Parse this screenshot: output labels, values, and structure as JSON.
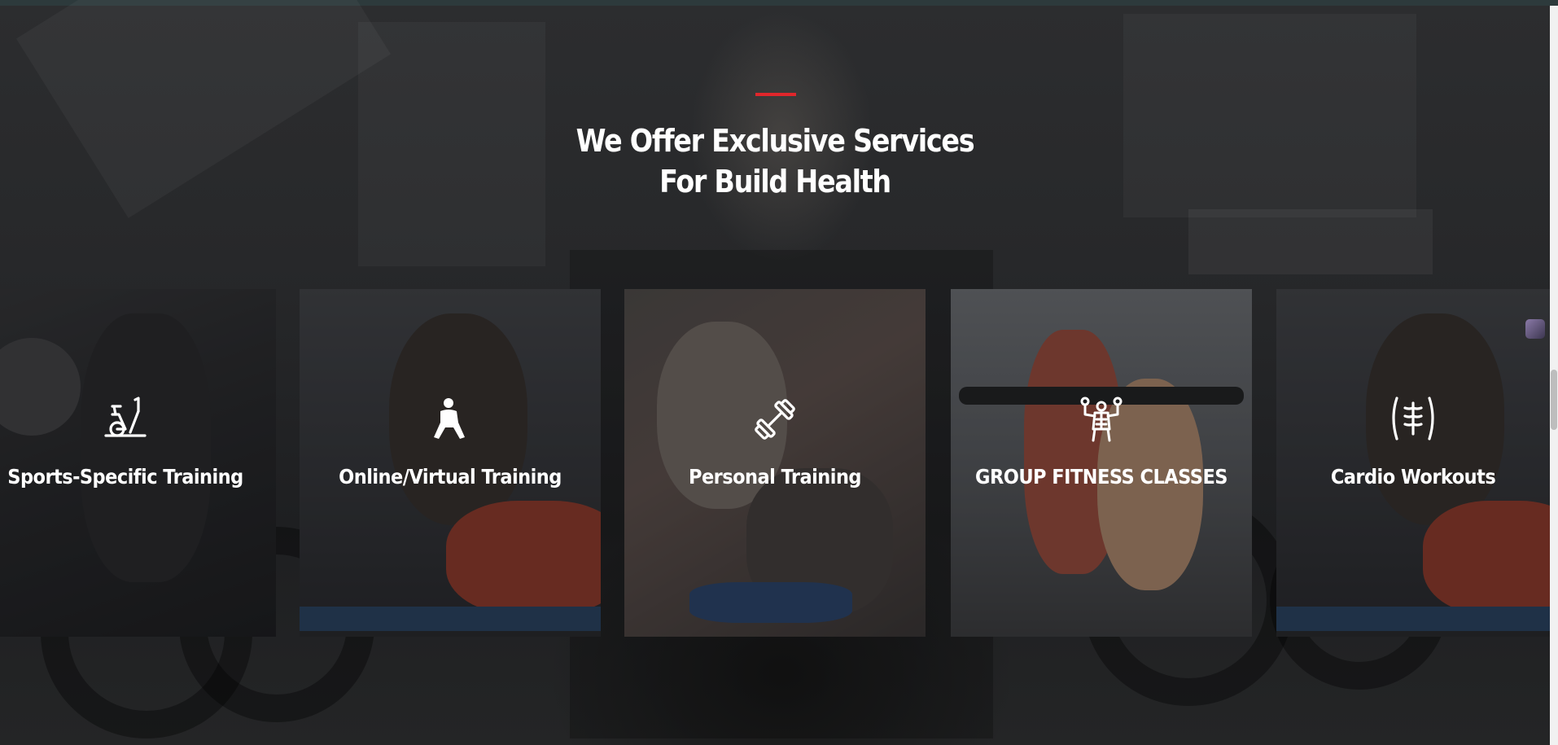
{
  "section": {
    "heading_line1": "We Offer Exclusive Services",
    "heading_line2": "For Build Health",
    "accent_color": "#e0262b"
  },
  "services": [
    {
      "title": "Sports-Specific Training",
      "icon": "exercise-bike-icon"
    },
    {
      "title": "Online/Virtual Training",
      "icon": "stretching-person-icon"
    },
    {
      "title": "Personal Training",
      "icon": "dumbbell-icon"
    },
    {
      "title": "GROUP FITNESS CLASSES",
      "icon": "bodybuilder-icon"
    },
    {
      "title": "Cardio Workouts",
      "icon": "abs-torso-icon"
    }
  ]
}
